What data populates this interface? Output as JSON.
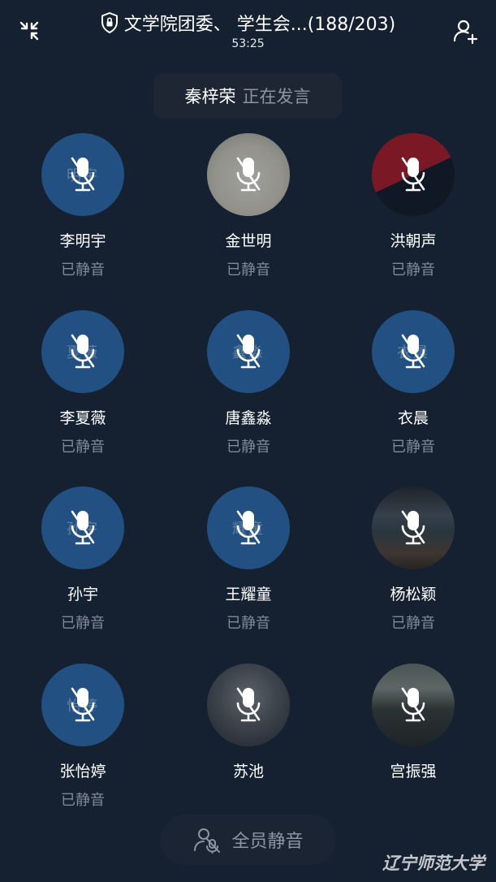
{
  "header": {
    "title": "文学院团委、 学生会...(188/203)",
    "timer": "53:25",
    "minimize_icon": "collapse-arrows-icon",
    "lock_icon": "shield-lock-icon",
    "add_member_icon": "add-user-icon"
  },
  "speaker": {
    "name": "秦梓荣",
    "status": "正在发言"
  },
  "members": [
    {
      "name": "李明宇",
      "status": "已静音",
      "initials": "明宇"
    },
    {
      "name": "金世明",
      "status": "已静音",
      "initials": ""
    },
    {
      "name": "洪朝声",
      "status": "已静音",
      "initials": ""
    },
    {
      "name": "李夏薇",
      "status": "已静音",
      "initials": "夏薇"
    },
    {
      "name": "唐鑫淼",
      "status": "已静音",
      "initials": "鑫淼"
    },
    {
      "name": "衣晨",
      "status": "已静音",
      "initials": "衣晨"
    },
    {
      "name": "孙宇",
      "status": "已静音",
      "initials": "孙宇"
    },
    {
      "name": "王耀童",
      "status": "已静音",
      "initials": "耀童"
    },
    {
      "name": "杨松颖",
      "status": "已静音",
      "initials": ""
    },
    {
      "name": "张怡婷",
      "status": "已静音",
      "initials": "怡婷"
    },
    {
      "name": "苏池",
      "status": "",
      "initials": ""
    },
    {
      "name": "宫振强",
      "status": "",
      "initials": ""
    }
  ],
  "footer": {
    "mute_all_label": "全员静音",
    "mute_all_icon": "mute-user-icon",
    "watermark": "辽宁师范大学"
  },
  "colors": {
    "background": "#152031",
    "avatar_default": "#225082",
    "muted_text": "#7f8997"
  }
}
